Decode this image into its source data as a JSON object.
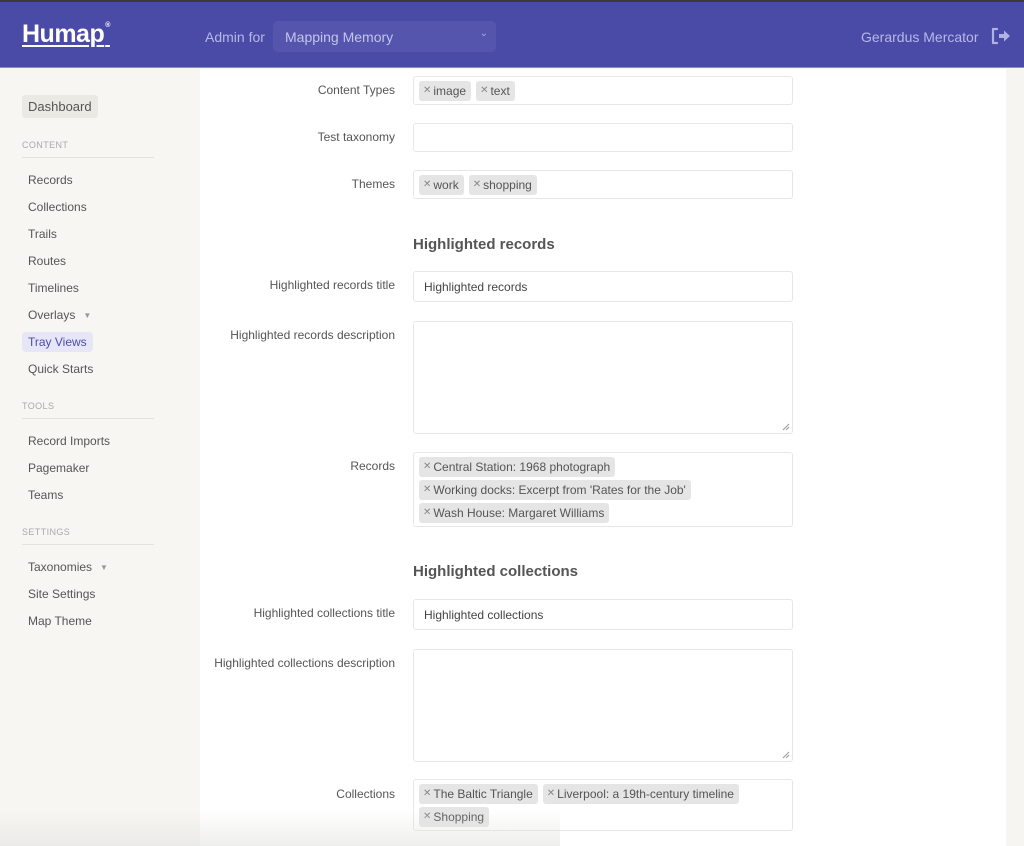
{
  "header": {
    "logo": "Humap",
    "logo_mark": "®",
    "admin_for_label": "Admin for",
    "site_selector": {
      "selected": "Mapping Memory"
    },
    "user_name": "Gerardus Mercator",
    "logout_icon": "sign-out-icon"
  },
  "sidebar": {
    "dashboard": "Dashboard",
    "sections": [
      {
        "title": "CONTENT",
        "items": [
          {
            "label": "Records"
          },
          {
            "label": "Collections"
          },
          {
            "label": "Trails"
          },
          {
            "label": "Routes"
          },
          {
            "label": "Timelines"
          },
          {
            "label": "Overlays",
            "has_dropdown": true
          },
          {
            "label": "Tray Views",
            "active": true
          },
          {
            "label": "Quick Starts"
          }
        ]
      },
      {
        "title": "TOOLS",
        "items": [
          {
            "label": "Record Imports"
          },
          {
            "label": "Pagemaker"
          },
          {
            "label": "Teams"
          }
        ]
      },
      {
        "title": "SETTINGS",
        "items": [
          {
            "label": "Taxonomies",
            "has_dropdown": true
          },
          {
            "label": "Site Settings"
          },
          {
            "label": "Map Theme"
          }
        ]
      }
    ]
  },
  "form": {
    "content_types": {
      "label": "Content Types",
      "tags": [
        "image",
        "text"
      ]
    },
    "test_taxonomy": {
      "label": "Test taxonomy",
      "tags": []
    },
    "themes": {
      "label": "Themes",
      "tags": [
        "work",
        "shopping"
      ]
    },
    "highlighted_records": {
      "heading": "Highlighted records",
      "title_label": "Highlighted records title",
      "title_value": "Highlighted records",
      "description_label": "Highlighted records description",
      "description_value": "",
      "records_label": "Records",
      "records": [
        "Central Station: 1968 photograph",
        "Working docks: Excerpt from 'Rates for the Job'",
        "Wash House: Margaret Williams"
      ]
    },
    "highlighted_collections": {
      "heading": "Highlighted collections",
      "title_label": "Highlighted collections title",
      "title_value": "Highlighted collections",
      "description_label": "Highlighted collections description",
      "description_value": "",
      "collections_label": "Collections",
      "collections": [
        "The Baltic Triangle",
        "Liverpool: a 19th-century timeline",
        "Shopping"
      ]
    }
  },
  "colors": {
    "header_bg": "#4a4ba6",
    "accent": "#4c4dac",
    "active_nav_bg": "#e6e6f6",
    "tag_bg": "#e5e5e5"
  }
}
